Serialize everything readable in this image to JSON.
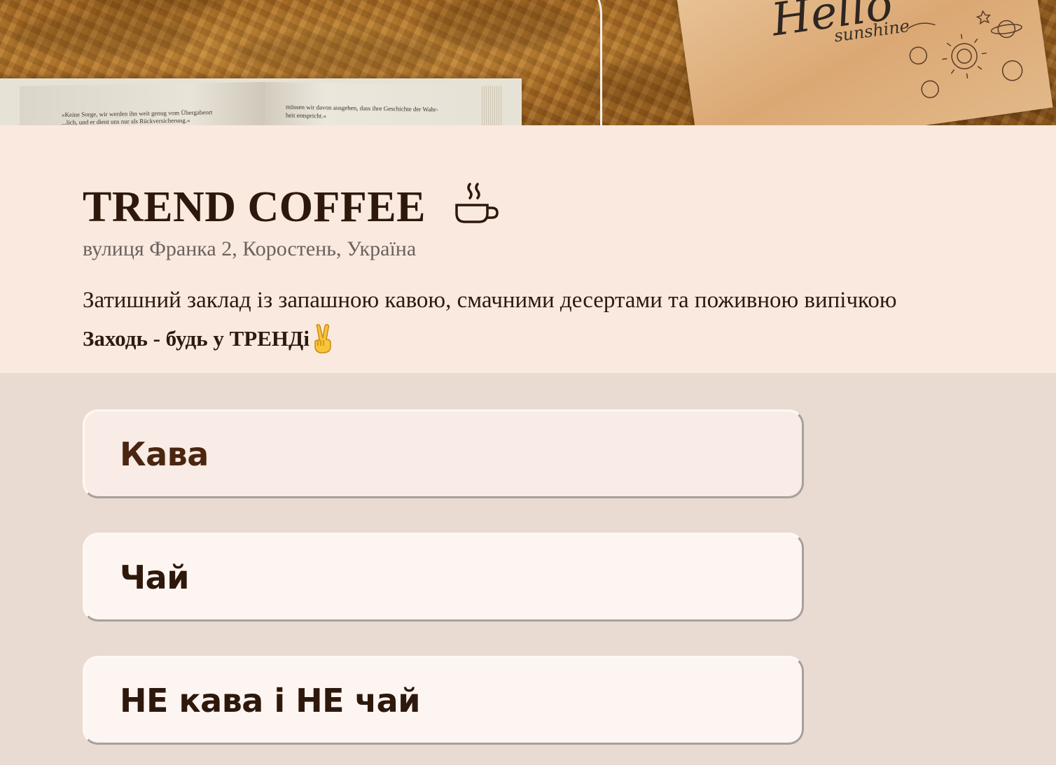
{
  "hero": {
    "image": "cozy-fur-blanket-book-card-photo",
    "card_text": [
      "Hello",
      "sunshine"
    ],
    "book_left_text": [
      "»Keine Sorge, wir werden ihn weit genug vom Übergabeort",
      "...lich, und er dient uns nur als Rückversicherung.«"
    ],
    "book_right_text": [
      "müssen wir davon ausgehen, dass ihre Geschichte der Wahr-",
      "heit entspricht.«"
    ]
  },
  "header": {
    "title": "TREND COFFEE",
    "title_icon": "coffee-cup-icon",
    "address": "вулиця Франка 2, Коростень, Україна",
    "description": "Затишний заклад із запашною кавою, смачними десертами та поживною випічкою",
    "slogan": "Заходь - будь у ТРЕНДі",
    "slogan_icon": "victory-hand-emoji"
  },
  "menu": {
    "categories": [
      {
        "label": "Кава",
        "color": "#4a2510",
        "active": true
      },
      {
        "label": "Чай",
        "color": "#2e180c",
        "active": false
      },
      {
        "label": "НЕ кава і НЕ чай",
        "color": "#2e180c",
        "active": false
      }
    ]
  },
  "colors": {
    "info_background": "#fae9df",
    "menu_background": "#e9dbd2",
    "button_background": "#fdf5f1",
    "title_text": "#2e180c"
  }
}
